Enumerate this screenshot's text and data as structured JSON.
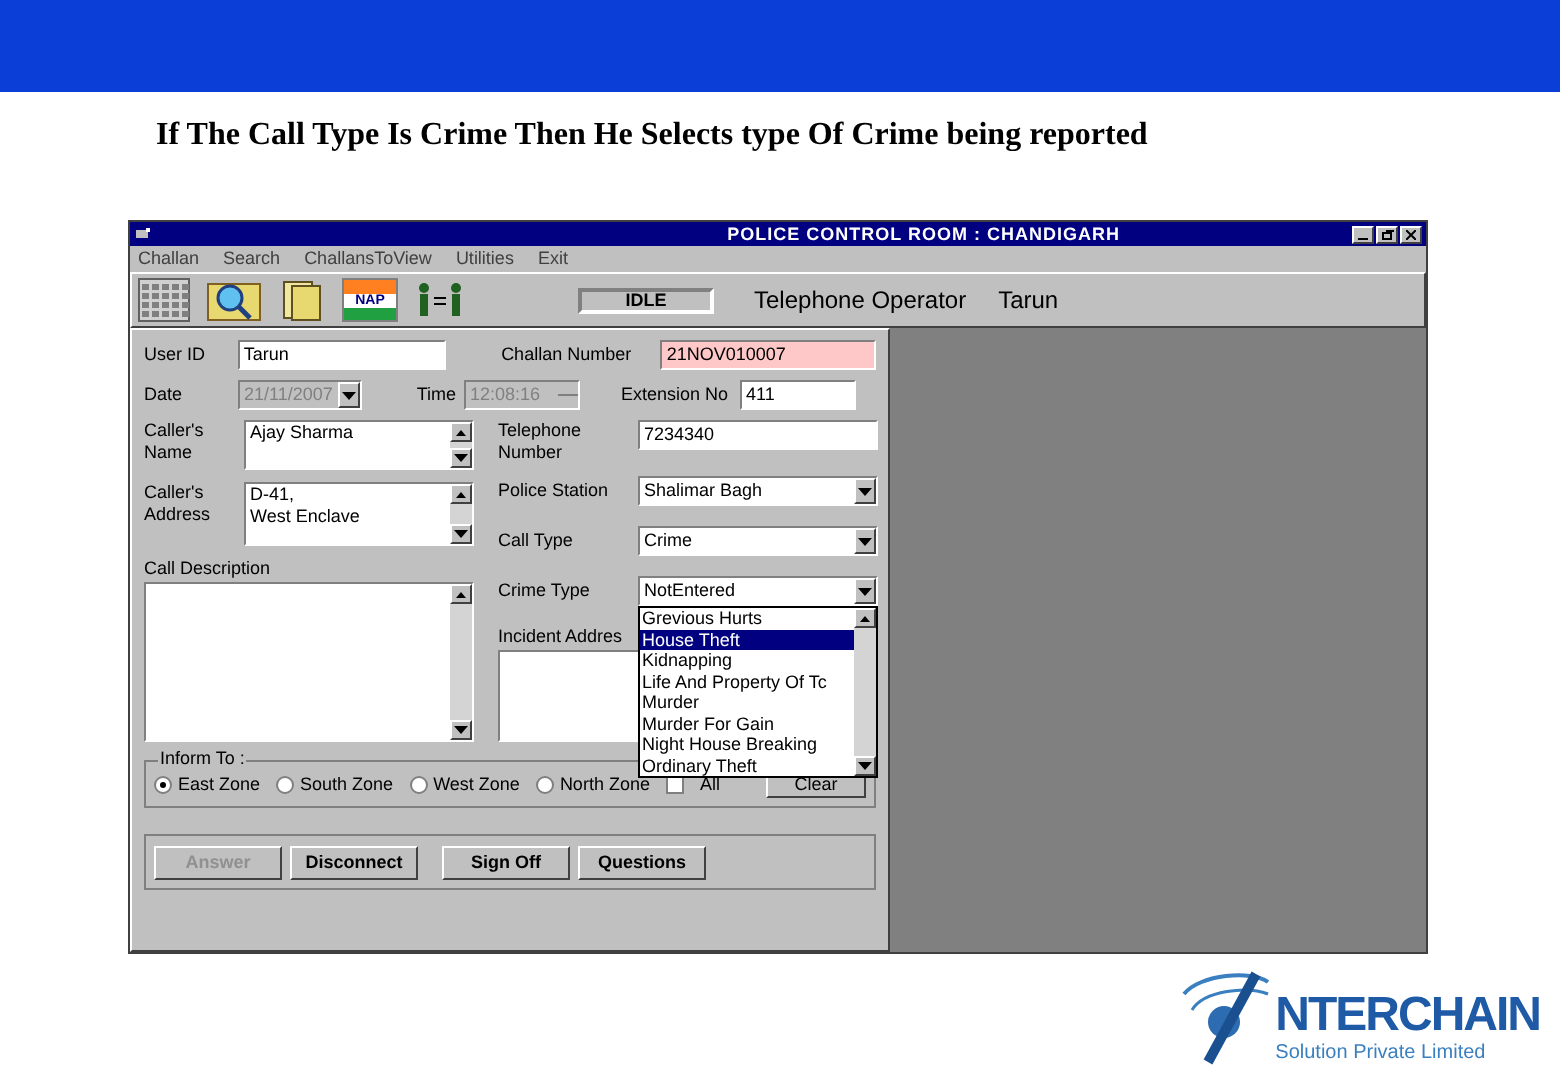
{
  "slide": {
    "title": "If The Call Type Is Crime Then He Selects type Of Crime being reported"
  },
  "window": {
    "title": "POLICE CONTROL ROOM : CHANDIGARH"
  },
  "menu": [
    "Challan",
    "Search",
    "ChallansToView",
    "Utilities",
    "Exit"
  ],
  "toolbar": {
    "flag_text": "NAP",
    "status": "IDLE",
    "role": "Telephone Operator",
    "user": "Tarun"
  },
  "form": {
    "user_id": {
      "label": "User ID",
      "value": "Tarun"
    },
    "challan_number": {
      "label": "Challan Number",
      "value": "21NOV010007"
    },
    "date": {
      "label": "Date",
      "value": "21/11/2007",
      "disabled": true
    },
    "time": {
      "label": "Time",
      "value": "12:08:16",
      "disabled": true
    },
    "extension_no": {
      "label": "Extension No",
      "value": "411"
    },
    "callers_name": {
      "label": "Caller's Name",
      "value": "Ajay Sharma"
    },
    "telephone_number": {
      "label": "Telephone Number",
      "value": "7234340"
    },
    "callers_address": {
      "label": "Caller's Address",
      "value": "D-41,\nWest Enclave"
    },
    "police_station": {
      "label": "Police Station",
      "value": "Shalimar Bagh"
    },
    "call_type": {
      "label": "Call Type",
      "value": "Crime"
    },
    "call_description": {
      "label": "Call Description"
    },
    "crime_type": {
      "label": "Crime Type",
      "value": "NotEntered",
      "options": [
        {
          "label": "Grevious Hurts",
          "selected": false
        },
        {
          "label": "House Theft",
          "selected": true
        },
        {
          "label": "Kidnapping",
          "selected": false
        },
        {
          "label": "Life And Property Of Tc",
          "selected": false
        },
        {
          "label": "Murder",
          "selected": false
        },
        {
          "label": "Murder For Gain",
          "selected": false
        },
        {
          "label": "Night House Breaking",
          "selected": false
        },
        {
          "label": "Ordinary Theft",
          "selected": false
        }
      ]
    },
    "incident_address": {
      "label": "Incident Addres"
    }
  },
  "inform": {
    "legend": "Inform To :",
    "zones": [
      {
        "label": "East Zone",
        "selected": true
      },
      {
        "label": "South Zone",
        "selected": false
      },
      {
        "label": "West Zone",
        "selected": false
      },
      {
        "label": "North Zone",
        "selected": false
      }
    ],
    "all": {
      "label": "All",
      "checked": false
    },
    "clear": "Clear"
  },
  "buttons": [
    {
      "label": "Answer",
      "disabled": true
    },
    {
      "label": "Disconnect",
      "disabled": false
    },
    {
      "label": "Sign Off",
      "disabled": false
    },
    {
      "label": "Questions",
      "disabled": false
    }
  ],
  "logo": {
    "name": "NTERCHAIN",
    "tagline": "Solution Private Limited"
  }
}
